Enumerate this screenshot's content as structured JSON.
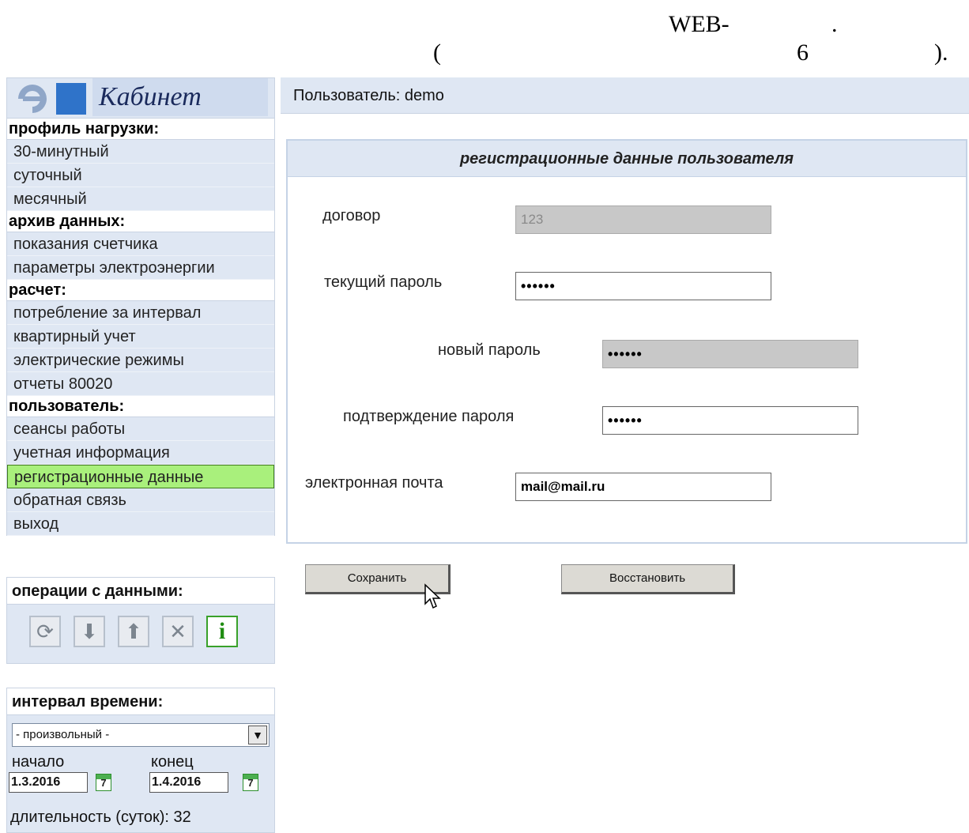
{
  "caption": {
    "line1_part1": "WEB-",
    "line1_part2": ".",
    "line2_open": "(",
    "line2_num": "6",
    "line2_close": ")."
  },
  "logo": {
    "text": "Кабинет"
  },
  "sidebar": {
    "sections": [
      {
        "title": "профиль нагрузки:",
        "items": [
          "30-минутный",
          "суточный",
          "месячный"
        ]
      },
      {
        "title": "архив данных:",
        "items": [
          "показания счетчика",
          "параметры электроэнергии"
        ]
      },
      {
        "title": "расчет:",
        "items": [
          "потребление за интервал",
          "квартирный учет",
          "электрические режимы",
          "отчеты 80020"
        ]
      },
      {
        "title": "пользователь:",
        "items": [
          "сеансы работы",
          "учетная информация",
          "регистрационные данные",
          "обратная связь",
          "выход"
        ]
      }
    ],
    "active_item": "регистрационные данные"
  },
  "operations": {
    "title": "операции с данными:",
    "icons": [
      "refresh-icon",
      "download-icon",
      "upload-icon",
      "excel-icon",
      "info-icon"
    ],
    "info_glyph": "i"
  },
  "interval": {
    "title": "интервал времени:",
    "selected": "- произвольный -",
    "start_label": "начало",
    "end_label": "конец",
    "start_value": "1.3.2016",
    "end_value": "1.4.2016",
    "calendar_glyph": "7",
    "duration": "длительность (суток): 32"
  },
  "topbar": {
    "user": "Пользователь: demo"
  },
  "form": {
    "title": "регистрационные данные пользователя",
    "contract_label": "договор",
    "contract_value": "123",
    "current_password_label": "текущий пароль",
    "current_password_value": "••••••",
    "new_password_label": "новый пароль",
    "new_password_value": "••••••",
    "confirm_label": "подтверждение пароля",
    "confirm_value": "••••••",
    "email_label": "электронная почта",
    "email_value": "mail@mail.ru"
  },
  "buttons": {
    "save": "Сохранить",
    "restore": "Восстановить"
  }
}
